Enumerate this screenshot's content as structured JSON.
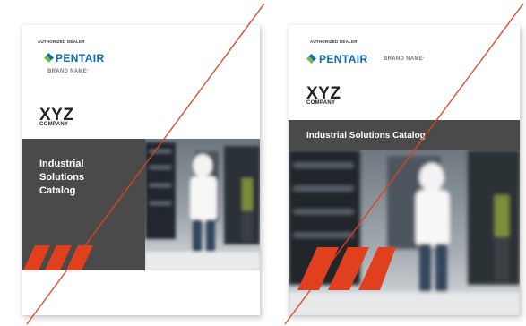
{
  "covers": [
    {
      "dealer_label": "AUTHORIZED DEALER",
      "logo_text": "PENTAIR",
      "brand_name": "BRAND NAME",
      "trademark": "*",
      "company_name": "XYZ",
      "company_subtitle": "COMPANY",
      "title_lines": [
        "Industrial",
        "Solutions",
        "Catalog"
      ]
    },
    {
      "dealer_label": "AUTHORIZED DEALER",
      "logo_text": "PENTAIR",
      "brand_name": "BRAND NAME",
      "trademark": "*",
      "company_name": "XYZ",
      "company_subtitle": "COMPANY",
      "title": "Industrial Solutions Catalog"
    }
  ],
  "colors": {
    "accent": "#e0401e",
    "brand_blue": "#0a6bb1",
    "brand_green": "#78b843",
    "band_grey": "#4a4a4a"
  },
  "icons": [
    "pentair-diamond-logo",
    "orange-slash-stripes",
    "data-center-photo",
    "strike-through-line"
  ]
}
